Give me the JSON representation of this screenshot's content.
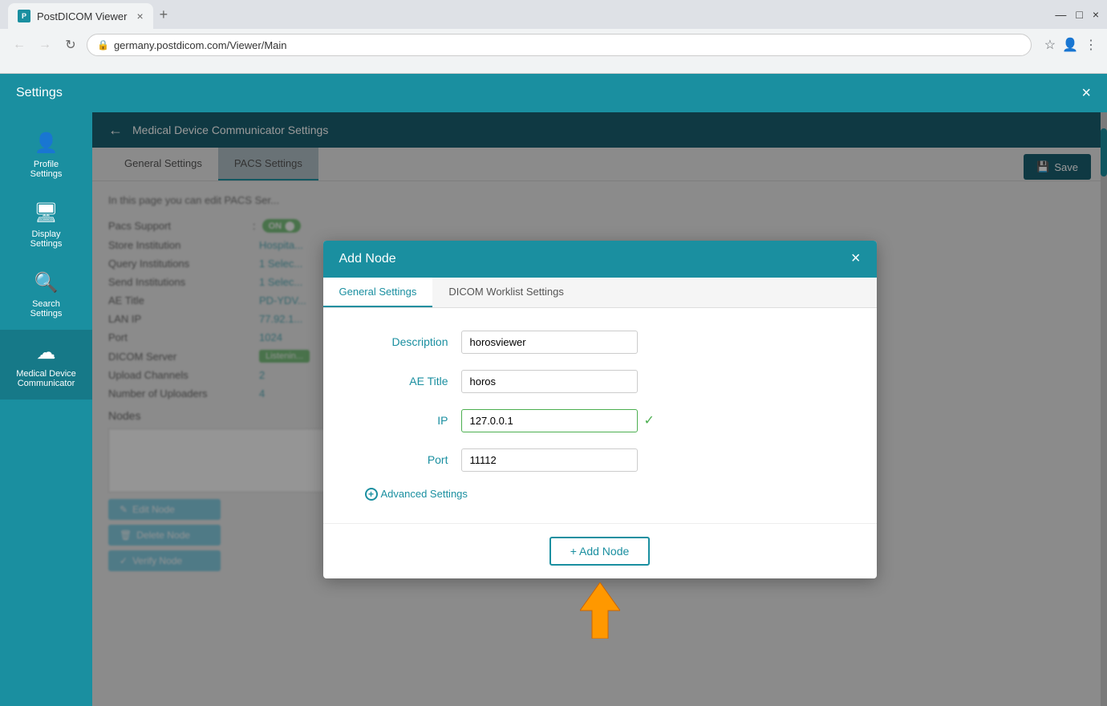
{
  "browser": {
    "tab_title": "PostDICOM Viewer",
    "tab_close": "×",
    "new_tab": "+",
    "back": "←",
    "forward": "→",
    "refresh": "↻",
    "address": "germany.postdicom.com/Viewer/Main",
    "window_minimize": "—",
    "window_maximize": "□",
    "window_close": "×"
  },
  "settings_modal": {
    "title": "Settings",
    "close": "×"
  },
  "sidebar": {
    "items": [
      {
        "id": "profile",
        "label": "Profile\nSettings",
        "icon": "👤"
      },
      {
        "id": "display",
        "label": "Display\nSettings",
        "icon": "🖥"
      },
      {
        "id": "search",
        "label": "Search\nSettings",
        "icon": "🔍"
      },
      {
        "id": "medical",
        "label": "Medical Device\nCommunicator",
        "icon": "☁"
      }
    ]
  },
  "subheader": {
    "back": "←",
    "title": "Medical Device Communicator Settings"
  },
  "tabs": {
    "general_label": "General Settings",
    "pacs_label": "PACS Settings",
    "save_label": "Save"
  },
  "pacs_content": {
    "description": "In this page you can edit PACS Ser...",
    "pacs_support_label": "Pacs Support",
    "pacs_support_value": "ON",
    "store_institution_label": "Store Institution",
    "store_institution_value": "Hospita...",
    "query_institutions_label": "Query Institutions",
    "query_institutions_value": "1 Selec...",
    "send_institutions_label": "Send Institutions",
    "send_institutions_value": "1 Selec...",
    "ae_title_label": "AE Title",
    "ae_title_value": "PD-YDV...",
    "lan_ip_label": "LAN IP",
    "lan_ip_value": "77.92.1...",
    "port_label": "Port",
    "port_value": "1024",
    "dicom_server_label": "DICOM Server",
    "dicom_server_value": "Listenin...",
    "upload_channels_label": "Upload Channels",
    "upload_channels_value": "2",
    "num_uploaders_label": "Number of Uploaders",
    "num_uploaders_value": "4",
    "nodes_label": "Nodes",
    "edit_node": "Edit Node",
    "delete_node": "Delete Node",
    "verify_node": "Verify Node"
  },
  "dialog": {
    "title": "Add Node",
    "close": "×",
    "tab_general": "General Settings",
    "tab_dicom": "DICOM Worklist Settings",
    "description_label": "Description",
    "description_value": "horosviewer",
    "ae_title_label": "AE Title",
    "ae_title_value": "horos",
    "ip_label": "IP",
    "ip_value": "127.0.0.1",
    "port_label": "Port",
    "port_value": "11112",
    "advanced_settings": "Advanced Settings",
    "add_node_btn": "+ Add Node"
  },
  "colors": {
    "primary": "#1a8fa0",
    "dark_primary": "#1a6070",
    "sidebar_bg": "#1a8fa0",
    "button_blue": "#5bc0de",
    "green": "#4caf50",
    "orange": "#ff9800"
  }
}
